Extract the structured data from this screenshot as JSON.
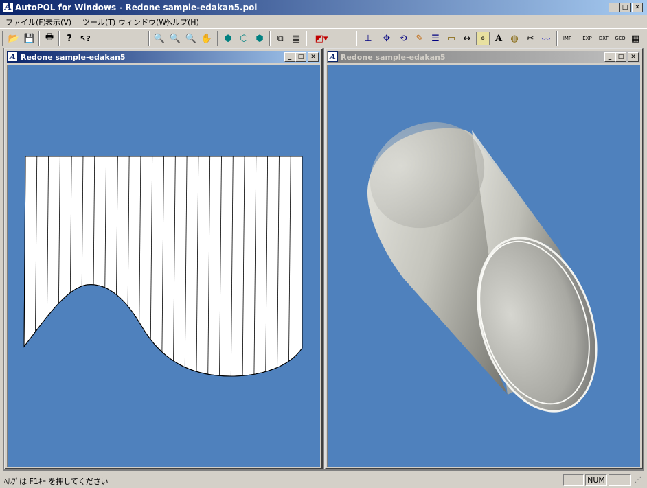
{
  "app": {
    "title": "AutoPOL for Windows - Redone sample-edakan5.pol",
    "icon": "autopol-app-icon",
    "icon_glyph": "A"
  },
  "window_controls": {
    "minimize": "_",
    "maximize": "□",
    "close": "✕"
  },
  "menu": {
    "items": [
      {
        "label": "ファイル(F)"
      },
      {
        "label": "表示(V)"
      },
      {
        "label": "ツール(T)"
      },
      {
        "label": "ウィンドウ(W)"
      },
      {
        "label": "ヘルプ(H)"
      }
    ]
  },
  "toolbar": {
    "buttons": [
      {
        "icon": "open-folder-icon",
        "glyph": "📂"
      },
      {
        "icon": "save-icon",
        "glyph": "💾"
      },
      {
        "icon": "print-icon",
        "glyph": "🖶"
      },
      {
        "icon": "help-icon",
        "glyph": "?"
      },
      {
        "icon": "context-help-icon",
        "glyph": "↖?"
      },
      {
        "icon": "zoom-window-icon",
        "glyph": "🔍"
      },
      {
        "icon": "zoom-in-icon",
        "glyph": "🔍"
      },
      {
        "icon": "zoom-fit-icon",
        "glyph": "🔍"
      },
      {
        "icon": "pan-hand-icon",
        "glyph": "✋"
      },
      {
        "icon": "view-iso-icon",
        "glyph": "⬢"
      },
      {
        "icon": "view-wire-icon",
        "glyph": "⬡"
      },
      {
        "icon": "view-solid-icon",
        "glyph": "⬢"
      },
      {
        "icon": "unfold-icon",
        "glyph": "⧉"
      },
      {
        "icon": "unfold-list-icon",
        "glyph": "▤"
      },
      {
        "icon": "cube-dropdown-icon",
        "glyph": "◩▾"
      },
      {
        "icon": "measure-base-icon",
        "glyph": "⊥"
      },
      {
        "icon": "move-icon",
        "glyph": "✥"
      },
      {
        "icon": "rotate-icon",
        "glyph": "⟲"
      },
      {
        "icon": "pen-icon",
        "glyph": "✎"
      },
      {
        "icon": "list-icon",
        "glyph": "☰"
      },
      {
        "icon": "ruler-icon",
        "glyph": "▭"
      },
      {
        "icon": "dimension-icon",
        "glyph": "↔"
      },
      {
        "icon": "marker-icon",
        "glyph": "⌖"
      },
      {
        "icon": "text-icon",
        "glyph": "A"
      },
      {
        "icon": "paint-icon",
        "glyph": "◍"
      },
      {
        "icon": "cut-icon",
        "glyph": "✂"
      },
      {
        "icon": "curve-icon",
        "glyph": "〰"
      },
      {
        "icon": "import-icon",
        "glyph": "IMP"
      },
      {
        "icon": "export-exp-icon",
        "glyph": "EXP"
      },
      {
        "icon": "export-dxf-icon",
        "glyph": "DXF"
      },
      {
        "icon": "export-geo-icon",
        "glyph": "GEO"
      },
      {
        "icon": "grid-icon",
        "glyph": "▦"
      }
    ]
  },
  "windows": [
    {
      "title": "Redone sample-edakan5",
      "state": "active"
    },
    {
      "title": "Redone sample-edakan5",
      "state": "inactive"
    }
  ],
  "views": {
    "background": "#4f81bd",
    "unfold_fill": "#ffffff",
    "pipe_light": "#e8e8e2",
    "pipe_dark": "#6e6e68"
  },
  "statusbar": {
    "help_text": "ﾍﾙﾌﾟは F1ｷｰ を押してください",
    "panes": [
      "",
      "NUM",
      ""
    ]
  }
}
